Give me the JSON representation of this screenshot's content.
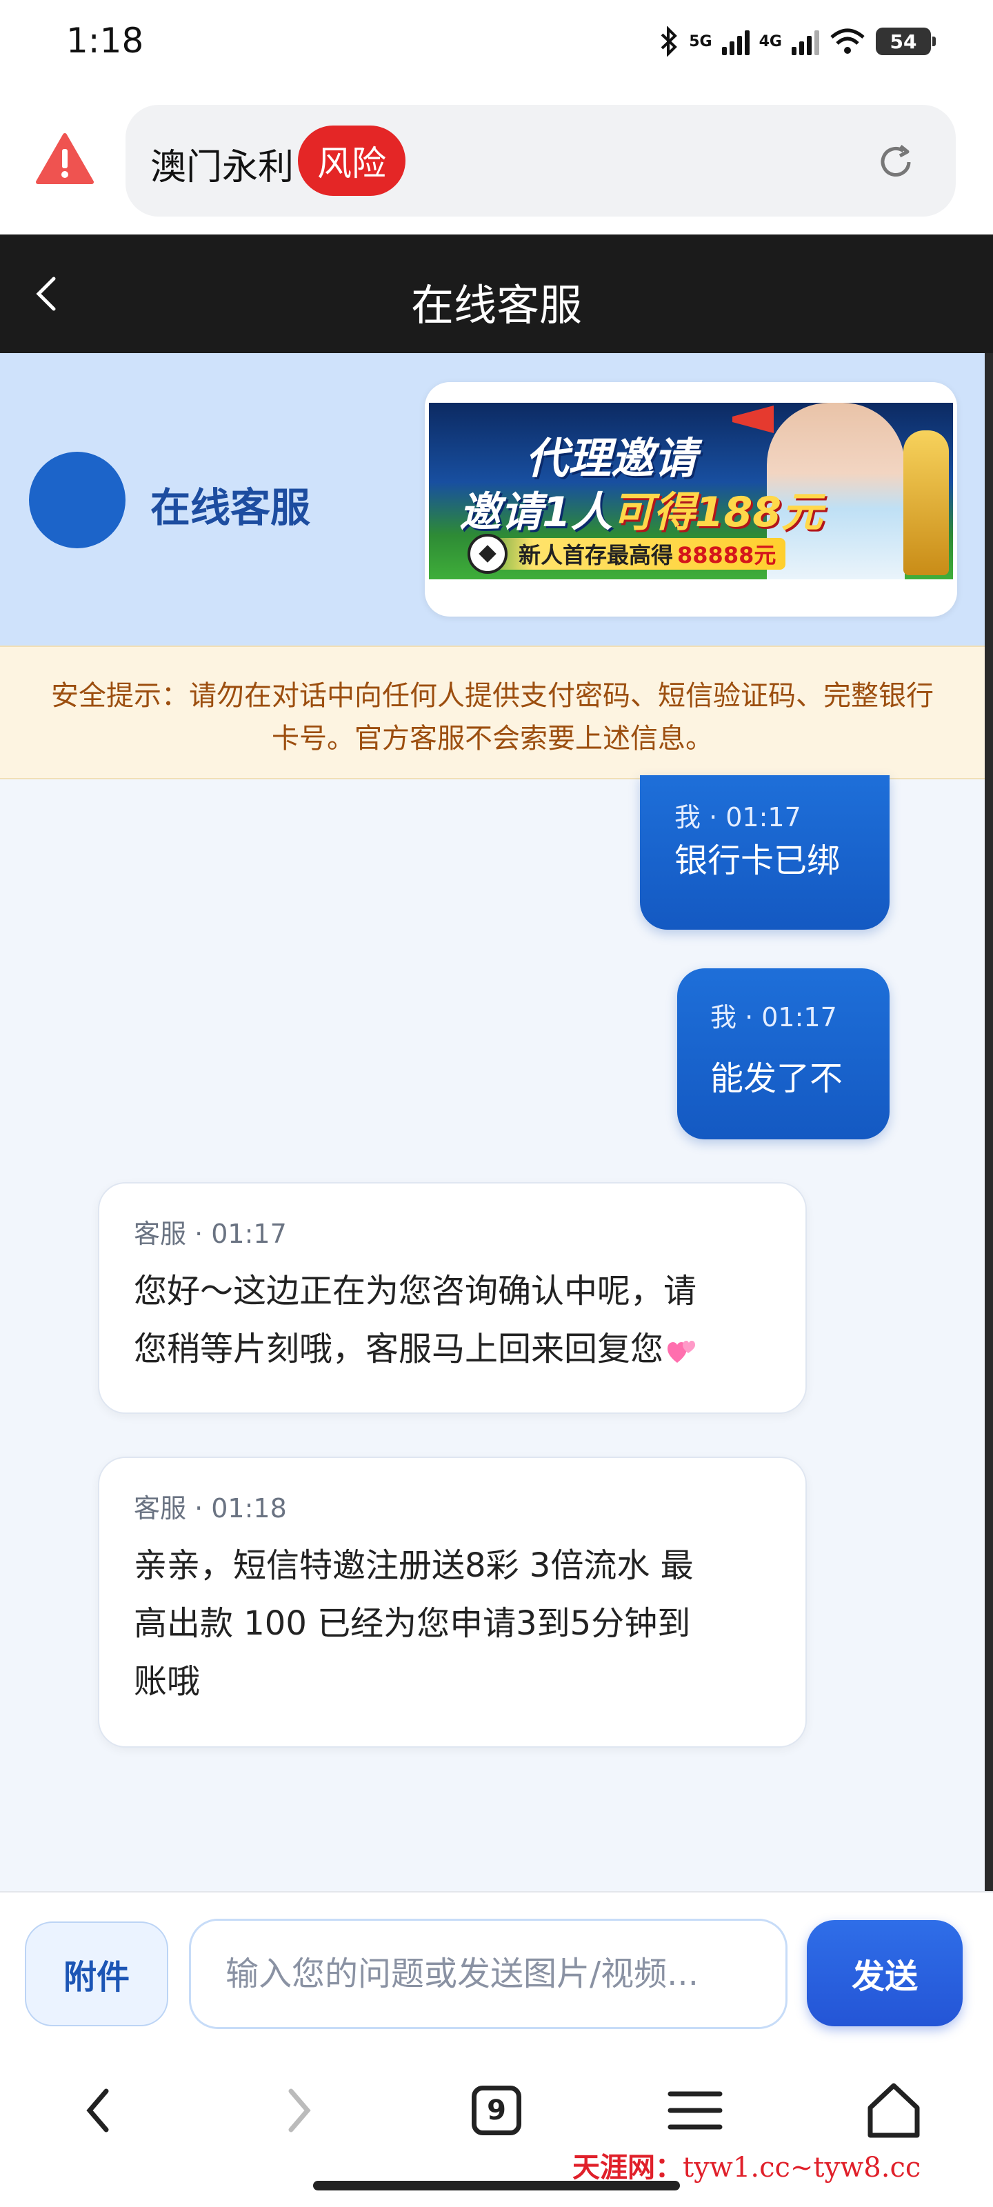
{
  "status_bar": {
    "time": "1:18",
    "net1": "5G",
    "net2": "4G",
    "battery": "54"
  },
  "address_bar": {
    "site_name": "澳门永利",
    "risk_label": "风险",
    "warning_icon": "warning-triangle-icon",
    "reload_icon": "reload-icon"
  },
  "title_bar": {
    "title": "在线客服",
    "back_icon": "chevron-left-icon"
  },
  "agent_header": {
    "name": "在线客服",
    "banner": {
      "line1": "代理邀请",
      "line2_prefix": "邀请1人",
      "line2_highlight": "可得188元",
      "line3_prefix": "新人首存最高得",
      "line3_amount": "88888元"
    }
  },
  "notice": {
    "text": "安全提示：请勿在对话中向任何人提供支付密码、短信验证码、完整银行卡号。官方客服不会索要上述信息。"
  },
  "messages": [
    {
      "sender": "me",
      "meta": "我 · 01:17",
      "text": "银行卡已绑"
    },
    {
      "sender": "me",
      "meta": "我 · 01:17",
      "text": "能发了不"
    },
    {
      "sender": "agent",
      "meta": "客服 · 01:17",
      "line1": "您好～这边正在为您咨询确认中呢，请",
      "line2": "您稍等片刻哦，客服马上回来回复您"
    },
    {
      "sender": "agent",
      "meta": "客服 · 01:18",
      "line1": "亲亲，短信特邀注册送8彩 3倍流水 最",
      "line2": "高出款 100  已经为您申请3到5分钟到",
      "line3": "账哦"
    }
  ],
  "input_bar": {
    "attach_label": "附件",
    "placeholder": "输入您的问题或发送图片/视频...",
    "value": "",
    "send_label": "发送"
  },
  "browser_nav": {
    "tab_count": "9",
    "icons": [
      "back-icon",
      "forward-icon",
      "tabs-icon",
      "menu-icon",
      "home-icon"
    ]
  },
  "watermark": {
    "prefix": "天涯网：",
    "urls": "tyw1.cc~tyw8.cc"
  },
  "colors": {
    "accent": "#1c64c9",
    "risk": "#e42626",
    "notice_text": "#9c4e0f",
    "title_bar": "#1b1b1b"
  }
}
